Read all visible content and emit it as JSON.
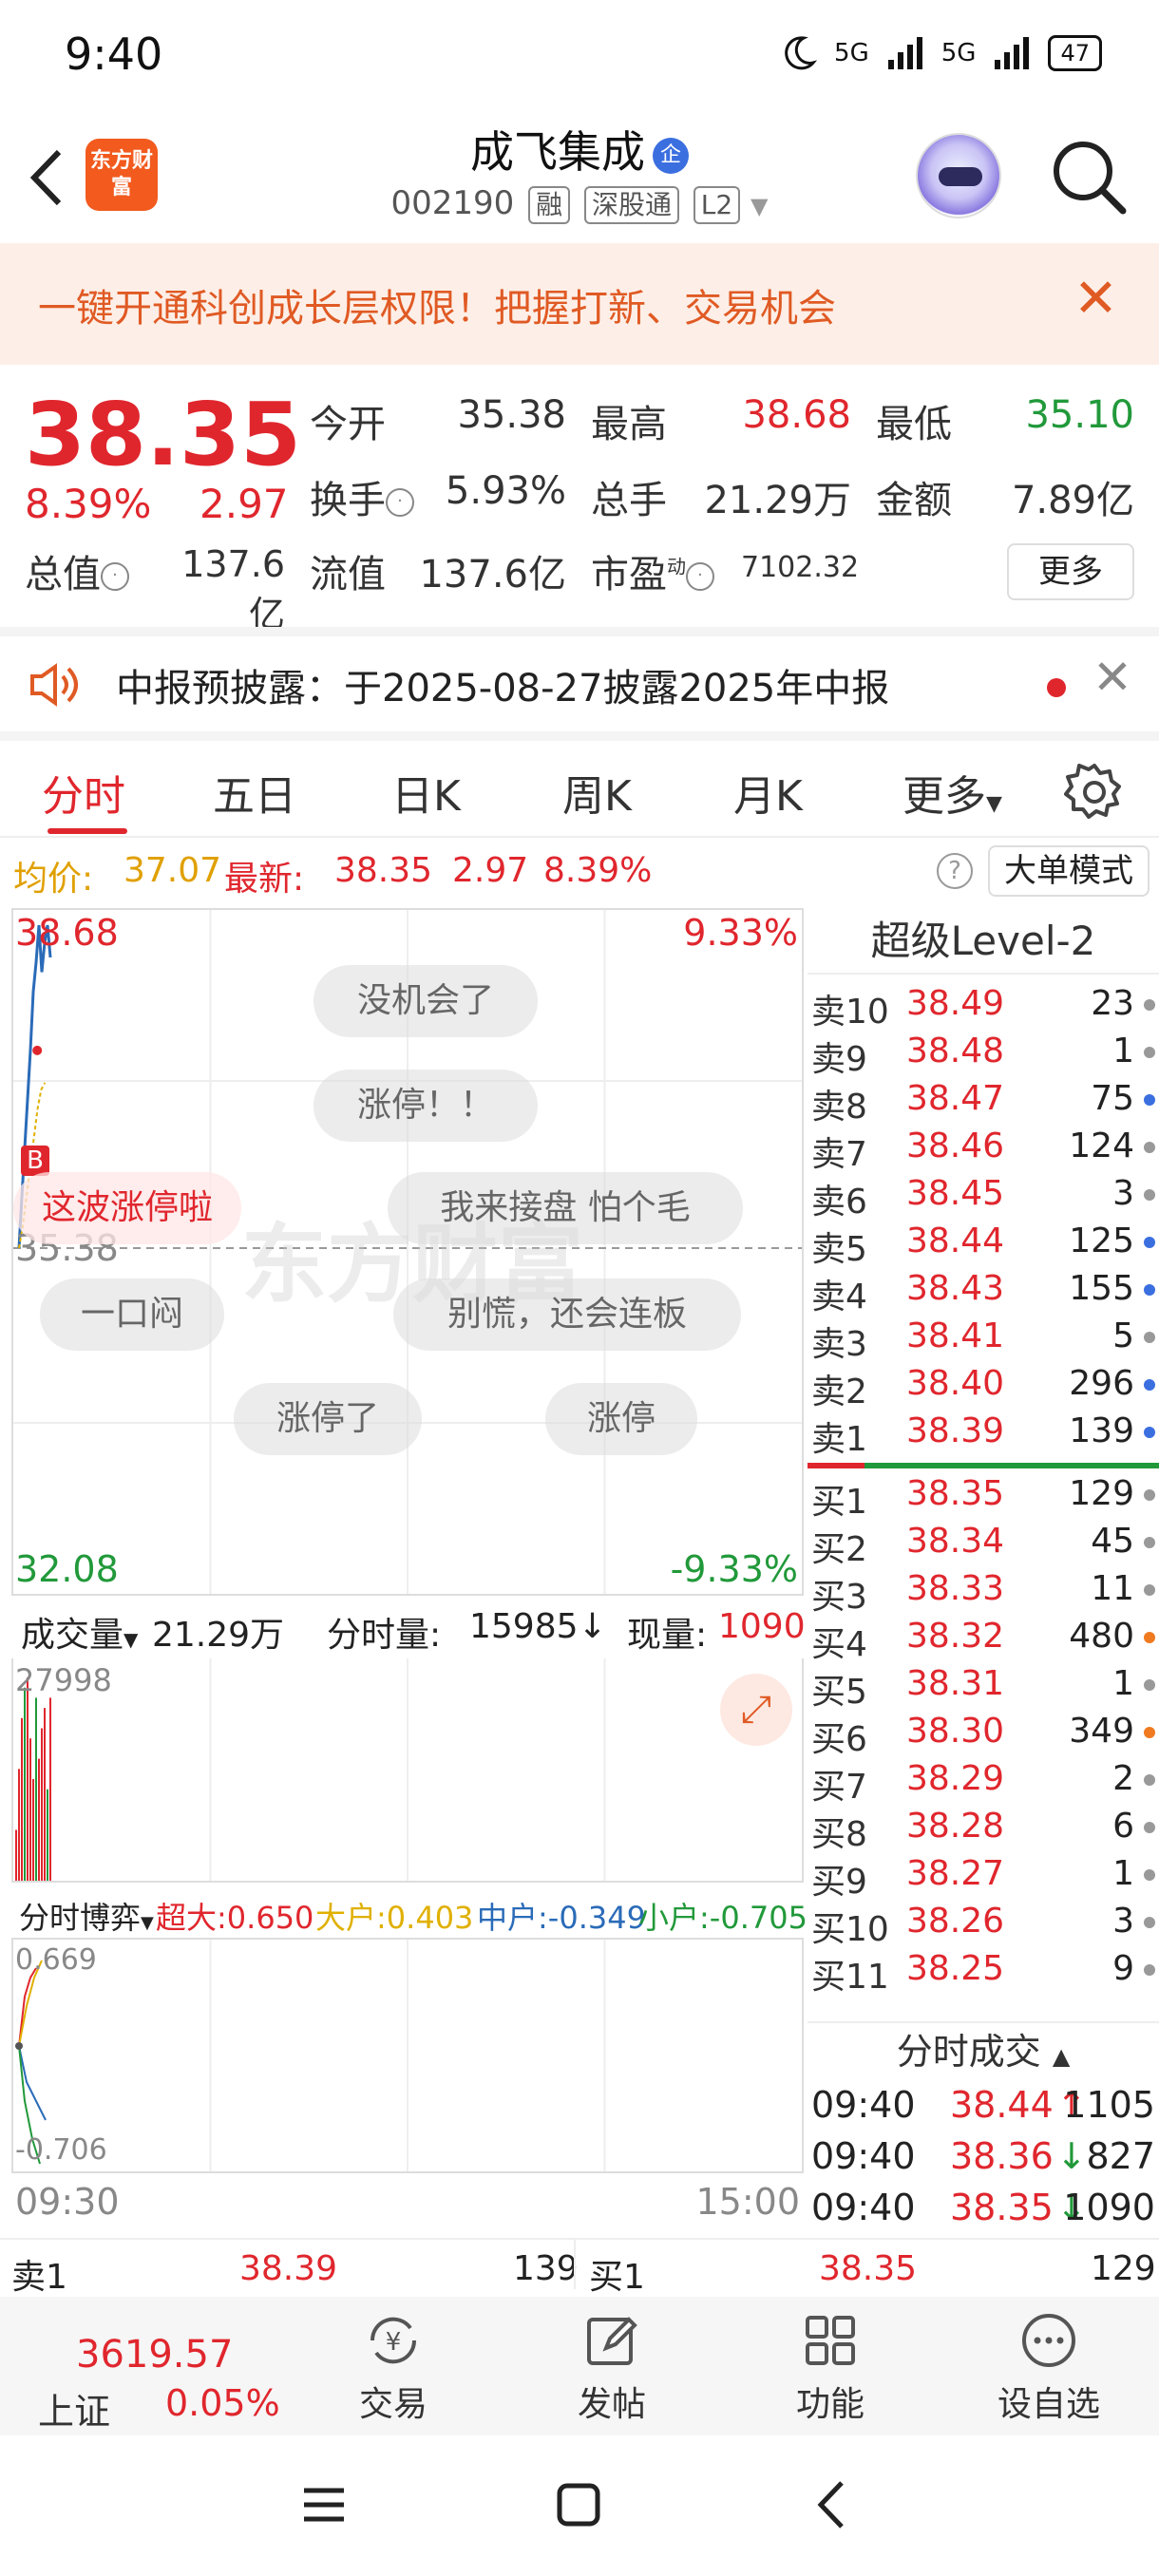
{
  "status": {
    "time": "9:40",
    "battery": "47",
    "net1": "5G",
    "net2": "5G"
  },
  "header": {
    "logo": "东方财富",
    "name": "成飞集成",
    "ent_badge": "企",
    "code": "002190",
    "tags": [
      "融",
      "深股通",
      "L2"
    ]
  },
  "promo": {
    "text": "一键开通科创成长层权限！把握打新、交易机会"
  },
  "quote": {
    "price": "38.35",
    "pct": "8.39%",
    "chg": "2.97",
    "open_label": "今开",
    "open": "35.38",
    "high_label": "最高",
    "high": "38.68",
    "low_label": "最低",
    "low": "35.10",
    "turn_label": "换手",
    "turn": "5.93%",
    "vol_label": "总手",
    "vol": "21.29万",
    "amt_label": "金额",
    "amt": "7.89亿",
    "mcap_label": "总值",
    "mcap": "137.6亿",
    "float_label": "流值",
    "float": "137.6亿",
    "pe_label": "市盈",
    "pe_sup": "动",
    "pe": "7102.32",
    "more": "更多"
  },
  "notice": {
    "text": "中报预披露：于2025-08-27披露2025年中报"
  },
  "tabs": [
    "分时",
    "五日",
    "日K",
    "周K",
    "月K",
    "更多"
  ],
  "avg": {
    "avg_label": "均价:",
    "avg": "37.07",
    "last_label": "最新:",
    "last": "38.35",
    "chg": "2.97",
    "pct": "8.39%",
    "bigmode": "大单模式"
  },
  "chart": {
    "top_price": "38.68",
    "top_pct": "9.33%",
    "base": "35.38",
    "bottom_price": "32.08",
    "bottom_pct": "-9.33%",
    "b_marker": "B",
    "watermark": "东方财富"
  },
  "chart_data": {
    "type": "line",
    "y_range": [
      32.08,
      38.68
    ],
    "base": 35.38,
    "price_points": [
      35.38,
      35.9,
      36.4,
      36.9,
      37.4,
      38.0,
      38.3,
      38.68,
      38.2,
      38.5,
      38.68,
      38.35
    ],
    "avg_points": [
      35.38,
      35.6,
      35.9,
      36.2,
      36.5,
      36.8,
      37.0,
      37.07
    ],
    "volume_max": "27998",
    "fund_max": "0.669",
    "fund_min": "-0.706",
    "time_start": "09:30",
    "time_end": "15:00"
  },
  "danmu": [
    "没机会了",
    "涨停！！",
    "这波涨停啦",
    "我来接盘 怕个毛",
    "一口闷",
    "别慌，还会连板",
    "涨停了",
    "涨停"
  ],
  "volume": {
    "label": "成交量",
    "total": "21.29万",
    "fen_label": "分时量:",
    "fen": "15985↓",
    "cur_label": "现量:",
    "cur": "1090",
    "max": "27998"
  },
  "fund": {
    "label": "分时博弈",
    "super_label": "超大:",
    "super": "0.650",
    "big_label": "大户:",
    "big": "0.403",
    "mid_label": "中户:",
    "mid": "-0.349",
    "small_label": "小户:",
    "small": "-0.705"
  },
  "times": {
    "start": "09:30",
    "end": "15:00"
  },
  "orderbook": {
    "title": "超级Level-2",
    "sells": [
      {
        "l": "卖10",
        "p": "38.49",
        "v": "23",
        "c": "#999"
      },
      {
        "l": "卖9",
        "p": "38.48",
        "v": "1",
        "c": "#999"
      },
      {
        "l": "卖8",
        "p": "38.47",
        "v": "75",
        "c": "#3b6fe0"
      },
      {
        "l": "卖7",
        "p": "38.46",
        "v": "124",
        "c": "#999"
      },
      {
        "l": "卖6",
        "p": "38.45",
        "v": "3",
        "c": "#999"
      },
      {
        "l": "卖5",
        "p": "38.44",
        "v": "125",
        "c": "#3b6fe0"
      },
      {
        "l": "卖4",
        "p": "38.43",
        "v": "155",
        "c": "#3b6fe0"
      },
      {
        "l": "卖3",
        "p": "38.41",
        "v": "5",
        "c": "#999"
      },
      {
        "l": "卖2",
        "p": "38.40",
        "v": "296",
        "c": "#3b6fe0"
      },
      {
        "l": "卖1",
        "p": "38.39",
        "v": "139",
        "c": "#3b6fe0"
      }
    ],
    "buys": [
      {
        "l": "买1",
        "p": "38.35",
        "v": "129",
        "c": "#999"
      },
      {
        "l": "买2",
        "p": "38.34",
        "v": "45",
        "c": "#999"
      },
      {
        "l": "买3",
        "p": "38.33",
        "v": "11",
        "c": "#999"
      },
      {
        "l": "买4",
        "p": "38.32",
        "v": "480",
        "c": "#f07a20"
      },
      {
        "l": "买5",
        "p": "38.31",
        "v": "1",
        "c": "#999"
      },
      {
        "l": "买6",
        "p": "38.30",
        "v": "349",
        "c": "#f07a20"
      },
      {
        "l": "买7",
        "p": "38.29",
        "v": "2",
        "c": "#999"
      },
      {
        "l": "买8",
        "p": "38.28",
        "v": "6",
        "c": "#999"
      },
      {
        "l": "买9",
        "p": "38.27",
        "v": "1",
        "c": "#999"
      },
      {
        "l": "买10",
        "p": "38.26",
        "v": "3",
        "c": "#999"
      },
      {
        "l": "买11",
        "p": "38.25",
        "v": "9",
        "c": "#999"
      }
    ]
  },
  "ticks": {
    "title": "分时成交",
    "rows": [
      {
        "t": "09:40",
        "p": "38.44",
        "a": "↑",
        "v": "1105",
        "ac": "#e0262d"
      },
      {
        "t": "09:40",
        "p": "38.36",
        "a": "↓",
        "v": "827",
        "ac": "#21993a"
      },
      {
        "t": "09:40",
        "p": "38.35",
        "a": "↓",
        "v": "1090",
        "ac": "#21993a"
      }
    ]
  },
  "bottom_quote": {
    "s_label": "卖1",
    "s_price": "38.39",
    "s_vol": "139",
    "b_label": "买1",
    "b_price": "38.35",
    "b_vol": "129"
  },
  "index": {
    "value": "3619.57",
    "name": "上证",
    "pct": "0.05%"
  },
  "nav": [
    "交易",
    "发帖",
    "功能",
    "设自选"
  ]
}
